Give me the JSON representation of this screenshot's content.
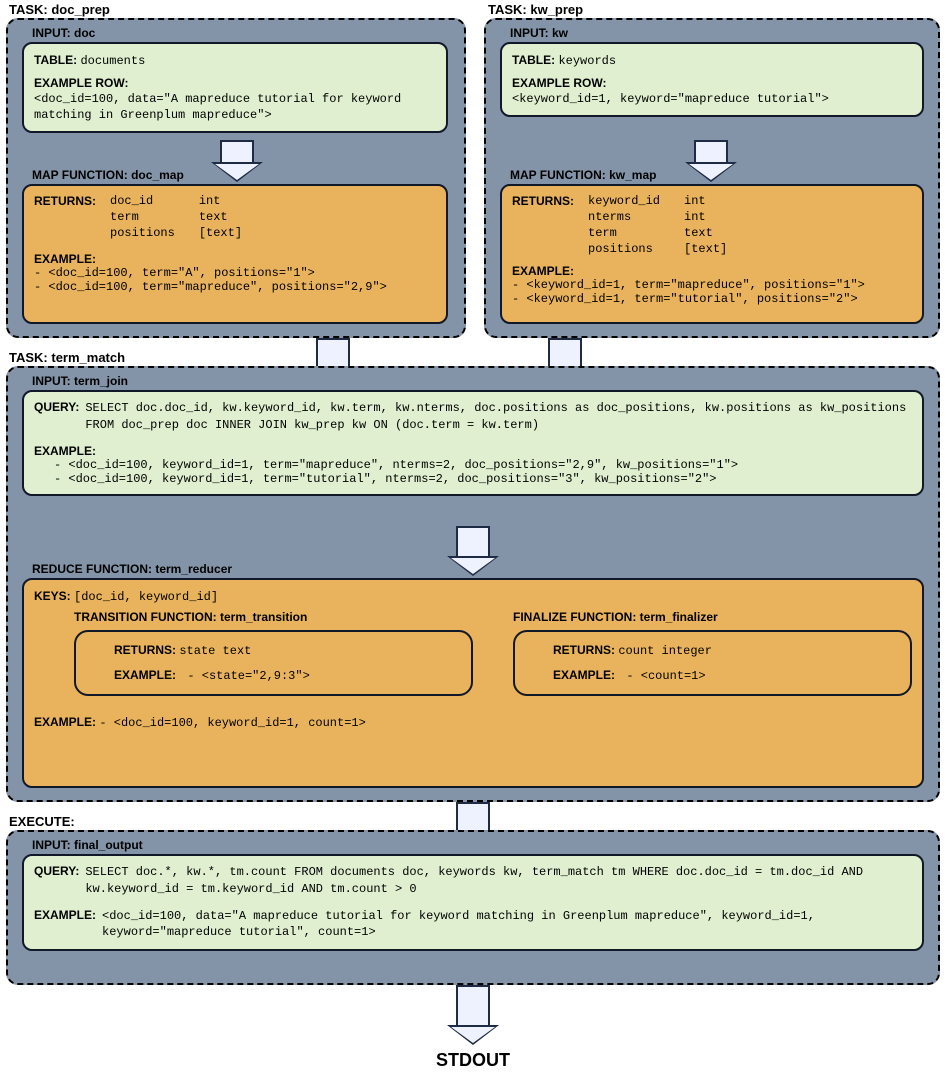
{
  "tasks": {
    "doc_prep": {
      "label": "TASK: doc_prep",
      "input": {
        "header": "INPUT: doc",
        "table_label": "TABLE:",
        "table_value": "documents",
        "example_row_label": "EXAMPLE ROW:",
        "example_row_value": "<doc_id=100, data=\"A mapreduce tutorial for keyword matching in Greenplum mapreduce\">"
      },
      "map": {
        "header": "MAP FUNCTION: doc_map",
        "returns_label": "RETURNS:",
        "returns": [
          {
            "name": "doc_id",
            "type": "int"
          },
          {
            "name": "term",
            "type": "text"
          },
          {
            "name": "positions",
            "type": "[text]"
          }
        ],
        "example_label": "EXAMPLE:",
        "example_lines": [
          "- <doc_id=100, term=\"A\", positions=\"1\">",
          "- <doc_id=100, term=\"mapreduce\", positions=\"2,9\">"
        ]
      }
    },
    "kw_prep": {
      "label": "TASK: kw_prep",
      "input": {
        "header": "INPUT: kw",
        "table_label": "TABLE:",
        "table_value": "keywords",
        "example_row_label": "EXAMPLE ROW:",
        "example_row_value": "<keyword_id=1, keyword=\"mapreduce tutorial\">"
      },
      "map": {
        "header": "MAP FUNCTION: kw_map",
        "returns_label": "RETURNS:",
        "returns": [
          {
            "name": "keyword_id",
            "type": "int"
          },
          {
            "name": "nterms",
            "type": "int"
          },
          {
            "name": "term",
            "type": "text"
          },
          {
            "name": "positions",
            "type": "[text]"
          }
        ],
        "example_label": "EXAMPLE:",
        "example_lines": [
          "- <keyword_id=1, term=\"mapreduce\", positions=\"1\">",
          "- <keyword_id=1, term=\"tutorial\", positions=\"2\">"
        ]
      }
    }
  },
  "term_match": {
    "label": "TASK: term_match",
    "input": {
      "header": "INPUT: term_join",
      "query_label": "QUERY:",
      "query_value": "SELECT doc.doc_id, kw.keyword_id, kw.term, kw.nterms, doc.positions as doc_positions, kw.positions as kw_positions FROM doc_prep doc INNER JOIN kw_prep kw ON (doc.term = kw.term)",
      "example_label": "EXAMPLE:",
      "example_lines": [
        "- <doc_id=100, keyword_id=1, term=\"mapreduce\", nterms=2, doc_positions=\"2,9\", kw_positions=\"1\">",
        "- <doc_id=100, keyword_id=1, term=\"tutorial\", nterms=2, doc_positions=\"3\", kw_positions=\"2\">"
      ]
    },
    "reduce": {
      "header": "REDUCE FUNCTION: term_reducer",
      "keys_label": "KEYS:",
      "keys_value": "[doc_id, keyword_id]",
      "transition": {
        "header": "TRANSITION FUNCTION: term_transition",
        "returns_label": "RETURNS:",
        "returns_value": "state   text",
        "example_label": "EXAMPLE:",
        "example_value": "- <state=\"2,9:3\">"
      },
      "finalize": {
        "header": "FINALIZE FUNCTION: term_finalizer",
        "returns_label": "RETURNS:",
        "returns_value": "count   integer",
        "example_label": "EXAMPLE:",
        "example_value": "- <count=1>"
      },
      "example_label": "EXAMPLE:",
      "example_value": "- <doc_id=100, keyword_id=1, count=1>"
    }
  },
  "execute": {
    "label": "EXECUTE:",
    "input": {
      "header": "INPUT: final_output",
      "query_label": "QUERY:",
      "query_value": "SELECT doc.*, kw.*, tm.count FROM documents doc, keywords kw, term_match tm WHERE doc.doc_id = tm.doc_id AND kw.keyword_id = tm.keyword_id AND tm.count > 0",
      "example_label": "EXAMPLE:",
      "example_value": "<doc_id=100, data=\"A mapreduce tutorial for keyword matching in Greenplum mapreduce\", keyword_id=1, keyword=\"mapreduce tutorial\", count=1>"
    }
  },
  "stdout": "STDOUT"
}
